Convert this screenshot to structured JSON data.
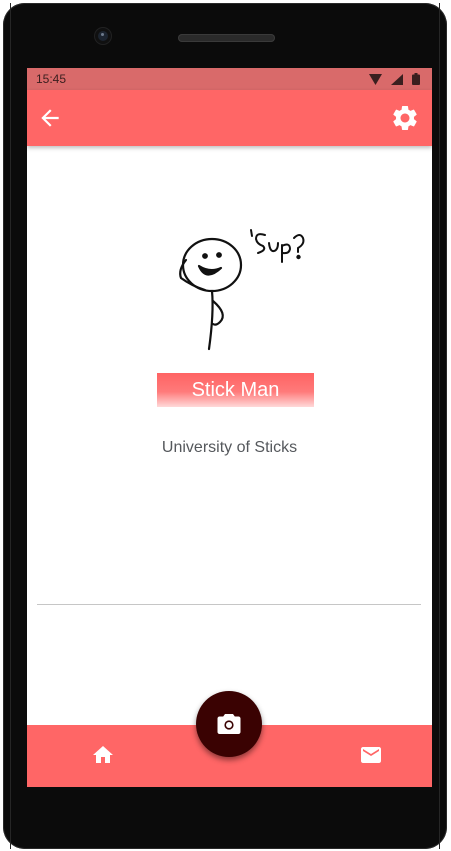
{
  "status_bar": {
    "time": "15:45",
    "icons": [
      "wifi-icon",
      "signal-icon",
      "battery-icon"
    ]
  },
  "app_bar": {
    "back_icon": "arrow-left-icon",
    "settings_icon": "gear-icon",
    "color": "#ff6666"
  },
  "profile": {
    "avatar_caption": "'Sup?",
    "name": "Stick Man",
    "school": "University of Sticks"
  },
  "bottom_nav": {
    "home_icon": "home-icon",
    "camera_icon": "camera-icon",
    "mail_icon": "mail-icon",
    "fab_color": "#3a0202"
  }
}
